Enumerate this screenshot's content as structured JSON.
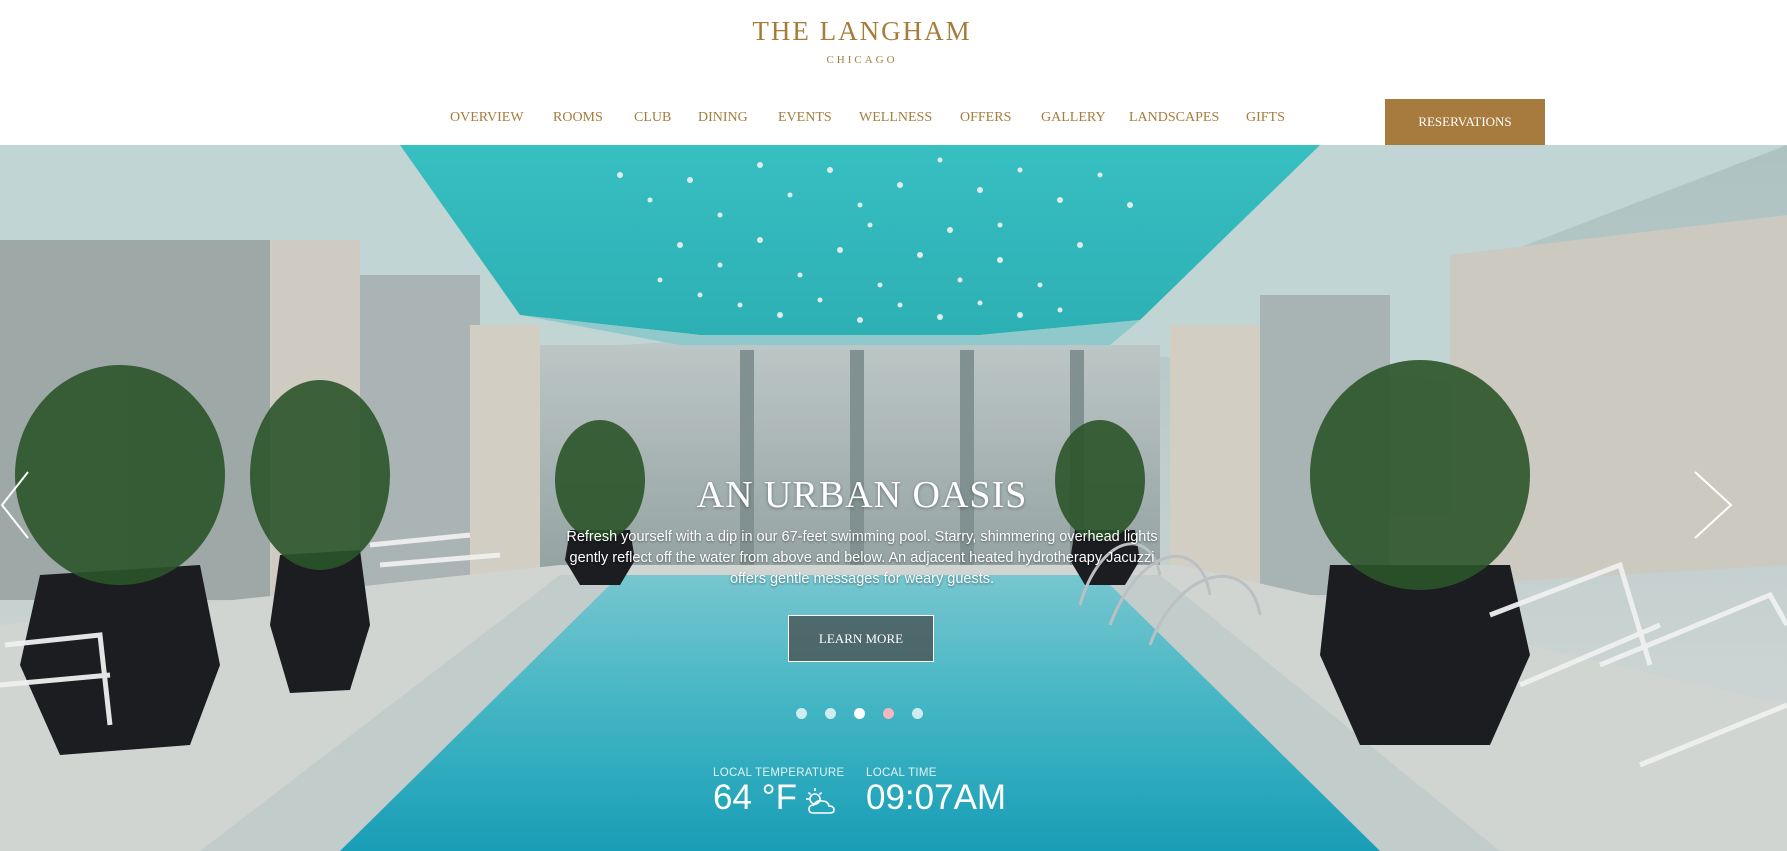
{
  "brand": {
    "name": "THE LANGHAM",
    "location": "CHICAGO",
    "color": "#a67c3b"
  },
  "nav": {
    "items": [
      {
        "label": "OVERVIEW"
      },
      {
        "label": "ROOMS"
      },
      {
        "label": "CLUB"
      },
      {
        "label": "DINING"
      },
      {
        "label": "EVENTS"
      },
      {
        "label": "WELLNESS"
      },
      {
        "label": "OFFERS"
      },
      {
        "label": "GALLERY"
      },
      {
        "label": "LANDSCAPES"
      },
      {
        "label": "GIFTS"
      }
    ],
    "reservations_label": "RESERVATIONS"
  },
  "hero": {
    "title": "AN URBAN OASIS",
    "description": "Refresh yourself with a dip in our 67-feet swimming pool. Starry, shimmering overhead lights gently reflect off the water from above and below. An adjacent heated hydrotherapy Jacuzzi offers gentle messages for weary guests.",
    "cta_label": "LEARN MORE",
    "slides_total": 5,
    "active_slide": 3,
    "prev_icon": "chevron-left-icon",
    "next_icon": "chevron-right-icon"
  },
  "widgets": {
    "temperature_label": "LOCAL TEMPERATURE",
    "temperature_value": "64 °F",
    "weather_icon": "partly-cloudy-icon",
    "time_label": "LOCAL TIME",
    "time_value": "09:07AM"
  }
}
